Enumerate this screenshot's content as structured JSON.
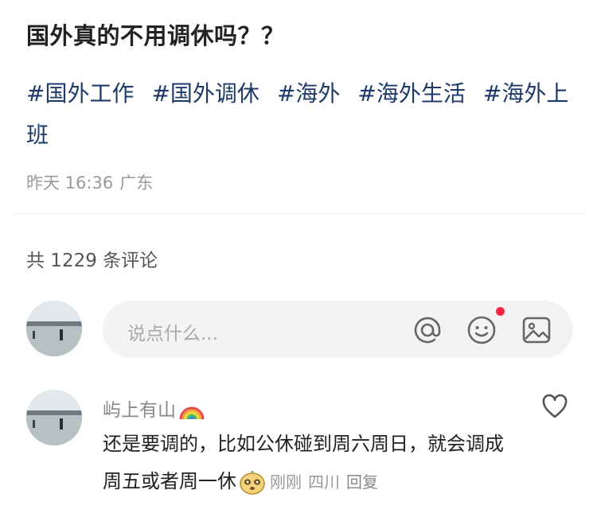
{
  "post": {
    "title": "国外真的不用调休吗？？",
    "tags": [
      "#国外工作",
      "#国外调休",
      "#海外",
      "#海外生活",
      "#海外上班"
    ],
    "date": "昨天 16:36",
    "location": "广东"
  },
  "comments_header": {
    "count_text": "共 1229 条评论"
  },
  "input": {
    "placeholder": "说点什么...",
    "icons": [
      "at-icon",
      "emoji-icon",
      "image-icon"
    ]
  },
  "comment": {
    "author": "屿上有山",
    "author_badge_icon": "rainbow-icon",
    "text": "还是要调的，比如公休碰到周六周日，就会调成周五或者周一休",
    "sticker_icon": "meerkat-sticker-icon",
    "time": "刚刚",
    "location": "四川",
    "reply_label": "回复"
  },
  "colors": {
    "tag": "#1e3a6a",
    "notification_dot": "#ff2442",
    "muted": "#999999"
  }
}
